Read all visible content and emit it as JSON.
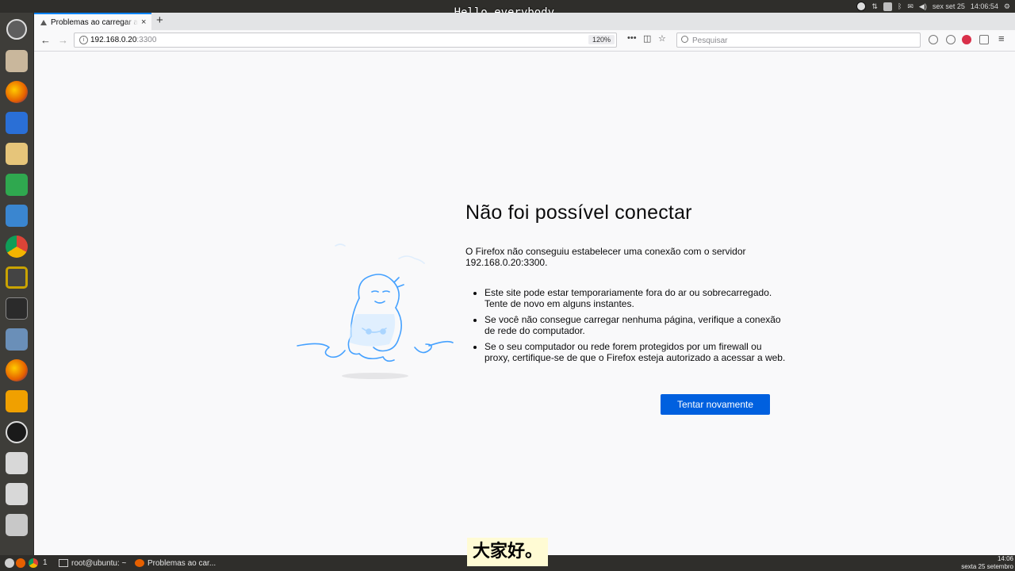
{
  "subtitles": {
    "top": "Hello everybody.",
    "bottom": "大家好。"
  },
  "system": {
    "date": "sex set 25",
    "time": "14:06:54"
  },
  "tab": {
    "title": "Problemas ao carregar a página",
    "close": "×",
    "new_tab": "+"
  },
  "url": {
    "host": "192.168.0.20",
    "port": ":3300",
    "zoom": "120%"
  },
  "search": {
    "placeholder": "Pesquisar"
  },
  "error": {
    "title": "Não foi possível conectar",
    "description": "O Firefox não conseguiu estabelecer uma conexão com o servidor 192.168.0.20:3300.",
    "items": [
      "Este site pode estar temporariamente fora do ar ou sobrecarregado. Tente de novo em alguns instantes.",
      "Se você não consegue carregar nenhuma página, verifique a conexão de rede do computador.",
      "Se o seu computador ou rede forem protegidos por um firewall ou proxy, certifique-se de que o Firefox esteja autorizado a acessar a web."
    ],
    "button": "Tentar novamente"
  },
  "taskbar": {
    "workspace": "1",
    "terminal": "root@ubuntu: ~",
    "firefox": "Problemas ao car...",
    "clock_time": "14:06",
    "clock_date": "sexta 25 setembro"
  },
  "colors": {
    "accent": "#0060df",
    "tab_highlight": "#0a84ff",
    "illustration": "#45a1ff"
  }
}
